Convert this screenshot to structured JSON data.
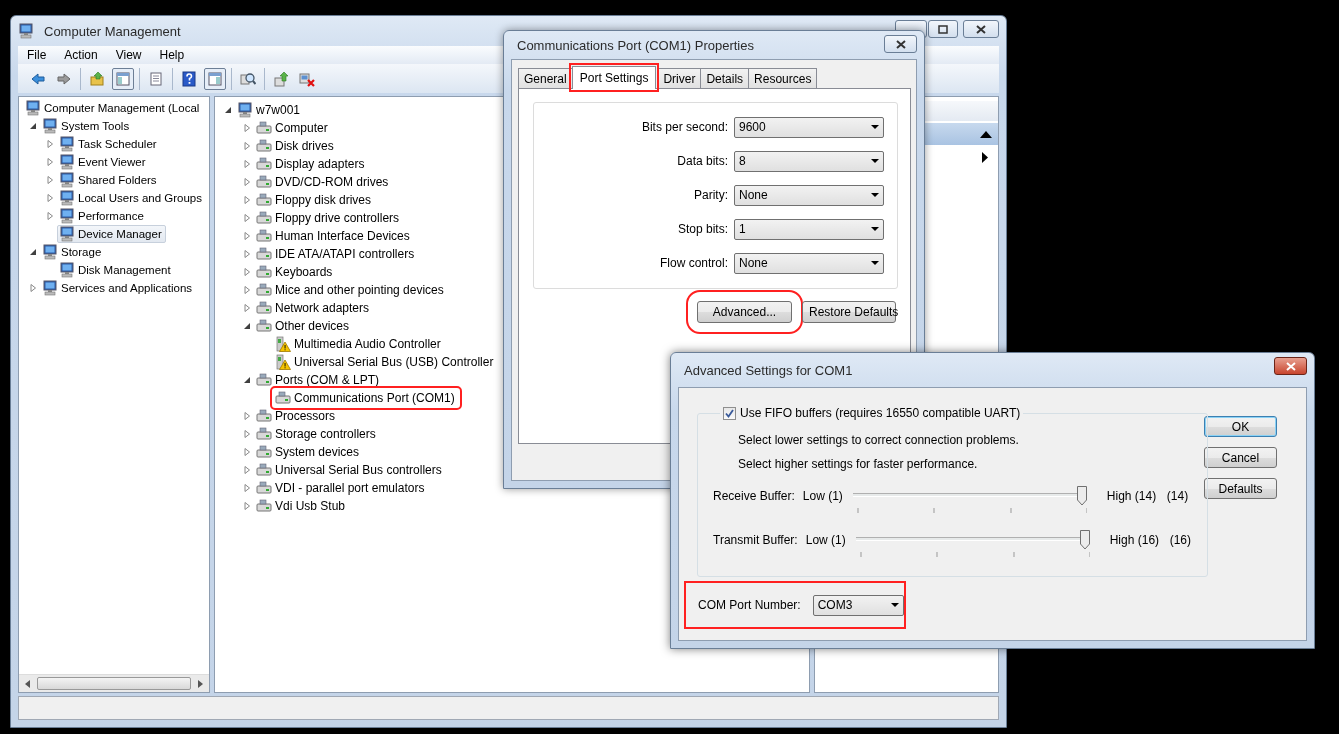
{
  "main_window": {
    "title": "Computer Management",
    "menu": [
      "File",
      "Action",
      "View",
      "Help"
    ],
    "toolbar": [
      {
        "buttons": [
          {
            "pressed": false
          },
          {
            "pressed": false
          }
        ]
      },
      {
        "buttons": [
          {
            "pressed": false
          },
          {
            "pressed": true
          }
        ]
      },
      {
        "buttons": [
          {
            "pressed": false
          }
        ]
      },
      {
        "buttons": [
          {
            "pressed": false
          },
          {
            "pressed": true
          }
        ]
      },
      {
        "buttons": [
          {
            "pressed": false
          }
        ]
      },
      {
        "buttons": [
          {
            "pressed": false
          },
          {
            "pressed": false
          }
        ]
      }
    ],
    "nav_tree": [
      {
        "label": "Computer Management (Local",
        "selected": false,
        "children": [
          {
            "label": "System Tools",
            "expanded": true,
            "selected": false,
            "children": [
              {
                "label": "Task Scheduler",
                "expanded": false,
                "selected": false
              },
              {
                "label": "Event Viewer",
                "expanded": false,
                "selected": false
              },
              {
                "label": "Shared Folders",
                "expanded": false,
                "selected": false
              },
              {
                "label": "Local Users and Groups",
                "expanded": false,
                "selected": false
              },
              {
                "label": "Performance",
                "expanded": false,
                "selected": false
              },
              {
                "label": "Device Manager",
                "selected": true
              }
            ]
          },
          {
            "label": "Storage",
            "expanded": true,
            "selected": false,
            "children": [
              {
                "label": "Disk Management",
                "selected": false
              }
            ]
          },
          {
            "label": "Services and Applications",
            "expanded": false,
            "selected": false
          }
        ]
      }
    ],
    "device_tree": [
      {
        "label": "w7w001",
        "expanded": true,
        "children": [
          {
            "label": "Computer",
            "expanded": false
          },
          {
            "label": "Disk drives",
            "expanded": false
          },
          {
            "label": "Display adapters",
            "expanded": false
          },
          {
            "label": "DVD/CD-ROM drives",
            "expanded": false
          },
          {
            "label": "Floppy disk drives",
            "expanded": false
          },
          {
            "label": "Floppy drive controllers",
            "expanded": false
          },
          {
            "label": "Human Interface Devices",
            "expanded": false
          },
          {
            "label": "IDE ATA/ATAPI controllers",
            "expanded": false
          },
          {
            "label": "Keyboards",
            "expanded": false
          },
          {
            "label": "Mice and other pointing devices",
            "expanded": false
          },
          {
            "label": "Network adapters",
            "expanded": false
          },
          {
            "label": "Other devices",
            "expanded": true,
            "children": [
              {
                "label": "Multimedia Audio Controller",
                "warning": true,
                "highlighted": false
              },
              {
                "label": "Universal Serial Bus (USB) Controller",
                "warning": true,
                "highlighted": false
              }
            ]
          },
          {
            "label": "Ports (COM & LPT)",
            "expanded": true,
            "children": [
              {
                "label": "Communications Port (COM1)",
                "warning": false,
                "highlighted": true
              }
            ]
          },
          {
            "label": "Processors",
            "expanded": false
          },
          {
            "label": "Storage controllers",
            "expanded": false
          },
          {
            "label": "System devices",
            "expanded": false
          },
          {
            "label": "Universal Serial Bus controllers",
            "expanded": false
          },
          {
            "label": "VDI - parallel port emulators",
            "expanded": false
          },
          {
            "label": "Vdi Usb Stub",
            "expanded": false
          }
        ]
      }
    ]
  },
  "properties_dialog": {
    "title": "Communications Port (COM1) Properties",
    "tabs": [
      {
        "label": "General",
        "selected": false,
        "highlighted": false
      },
      {
        "label": "Port Settings",
        "selected": true,
        "highlighted": true
      },
      {
        "label": "Driver",
        "selected": false,
        "highlighted": false
      },
      {
        "label": "Details",
        "selected": false,
        "highlighted": false
      },
      {
        "label": "Resources",
        "selected": false,
        "highlighted": false
      }
    ],
    "settings": [
      {
        "label": "Bits per second:",
        "value": "9600"
      },
      {
        "label": "Data bits:",
        "value": "8"
      },
      {
        "label": "Parity:",
        "value": "None"
      },
      {
        "label": "Stop bits:",
        "value": "1"
      },
      {
        "label": "Flow control:",
        "value": "None"
      }
    ],
    "buttons": [
      {
        "label": "Advanced...",
        "highlighted": true
      },
      {
        "label": "Restore Defaults",
        "highlighted": false
      }
    ]
  },
  "advanced_dialog": {
    "title": "Advanced Settings for COM1",
    "fifo": {
      "label": "Use FIFO buffers (requires 16550 compatible UART)",
      "checked": true
    },
    "notes": [
      "Select lower settings to correct connection problems.",
      "Select higher settings for faster performance."
    ],
    "buffers": [
      {
        "label": "Receive Buffer:",
        "low": "Low (1)",
        "high": "High (14)",
        "reading": "(14)",
        "level": 1
      },
      {
        "label": "Transmit Buffer:",
        "low": "Low (1)",
        "high": "High (16)",
        "reading": "(16)",
        "level": 1
      }
    ],
    "com_port": {
      "label": "COM Port Number:",
      "value": "COM3",
      "highlighted": true
    },
    "buttons": [
      {
        "label": "OK",
        "default": true
      },
      {
        "label": "Cancel",
        "default": false
      },
      {
        "label": "Defaults",
        "default": false
      }
    ]
  }
}
